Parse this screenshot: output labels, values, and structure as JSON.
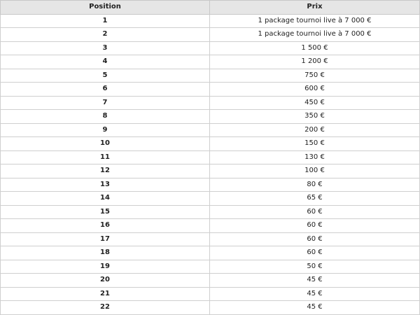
{
  "table": {
    "headers": {
      "position": "Position",
      "prize": "Prix"
    },
    "rows": [
      {
        "position": "1",
        "prize": "1 package tournoi live à 7 000 €"
      },
      {
        "position": "2",
        "prize": "1 package tournoi live à 7 000 €"
      },
      {
        "position": "3",
        "prize": "1 500 €"
      },
      {
        "position": "4",
        "prize": "1 200 €"
      },
      {
        "position": "5",
        "prize": "750 €"
      },
      {
        "position": "6",
        "prize": "600 €"
      },
      {
        "position": "7",
        "prize": "450 €"
      },
      {
        "position": "8",
        "prize": "350 €"
      },
      {
        "position": "9",
        "prize": "200 €"
      },
      {
        "position": "10",
        "prize": "150 €"
      },
      {
        "position": "11",
        "prize": "130 €"
      },
      {
        "position": "12",
        "prize": "100 €"
      },
      {
        "position": "13",
        "prize": "80 €"
      },
      {
        "position": "14",
        "prize": "65 €"
      },
      {
        "position": "15",
        "prize": "60 €"
      },
      {
        "position": "16",
        "prize": "60 €"
      },
      {
        "position": "17",
        "prize": "60 €"
      },
      {
        "position": "18",
        "prize": "60 €"
      },
      {
        "position": "19",
        "prize": "50 €"
      },
      {
        "position": "20",
        "prize": "45 €"
      },
      {
        "position": "21",
        "prize": "45 €"
      },
      {
        "position": "22",
        "prize": "45 €"
      }
    ]
  }
}
